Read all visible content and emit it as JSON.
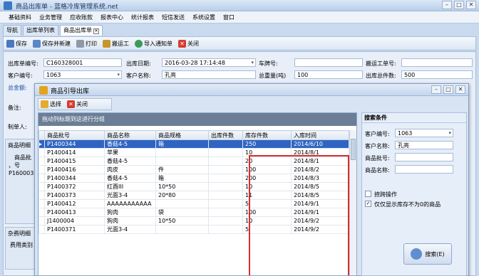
{
  "window": {
    "title": "商品出库单 - 蓝格冷库管理系统.net"
  },
  "menu": [
    "基础资料",
    "业务管理",
    "应收账款",
    "报表中心",
    "统计报表",
    "短信发送",
    "系统设置",
    "窗口"
  ],
  "tabs": [
    "导航",
    "出库单列表",
    "商品出库单"
  ],
  "toolbar": {
    "save": "保存",
    "save_new": "保存并新建",
    "print": "打印",
    "carry": "搬运工",
    "import": "导入通知单",
    "close": "关闭"
  },
  "form": {
    "no_label": "出库单编号:",
    "no_value": "C160328001",
    "date_label": "出库日期:",
    "date_value": "2016-03-28  17:14:48",
    "car_label": "车牌号:",
    "worker_label": "搬运工单号:",
    "cust_label": "客户编号:",
    "cust_value": "1063",
    "custname_label": "客户名称:",
    "custname_value": "孔亮",
    "weight_label": "总重量(吨)",
    "weight_value": "100",
    "count_label": "出库总件数:",
    "count_value": "500",
    "total_label": "总金额:",
    "note_label": "备注:",
    "maker_label": "制单人:",
    "detail_tab": "商品明细",
    "detail_col": "商品批号",
    "detail_row": "P160003",
    "misc_tab": "杂费明细",
    "misc_col": "费用类别"
  },
  "dialog": {
    "title": "商品引导出库",
    "select": "选择",
    "close": "关闭",
    "group_hint": "拖动列标题到这进行分组",
    "columns": [
      "商品批号",
      "商品名称",
      "商品规格",
      "出库件数",
      "库存件数",
      "入库时间"
    ],
    "rows": [
      [
        "P1400344",
        "香菇4-5",
        "箱",
        "",
        "250",
        "2014/6/10"
      ],
      [
        "P1400414",
        "苹果",
        "",
        "",
        "10",
        "2014/8/1"
      ],
      [
        "P1400415",
        "香菇4-5",
        "",
        "",
        "20",
        "2014/8/1"
      ],
      [
        "P1400416",
        "肉皮",
        "件",
        "",
        "100",
        "2014/8/2"
      ],
      [
        "P1400344",
        "香菇4-5",
        "箱",
        "",
        "200",
        "2014/8/3"
      ],
      [
        "P1400372",
        "红酉III",
        "10*50",
        "",
        "10",
        "2014/8/5"
      ],
      [
        "P1400373",
        "光面3-4",
        "20*80",
        "",
        "11",
        "2014/8/5"
      ],
      [
        "P1400412",
        "AAAAAAAAAAA",
        "",
        "",
        "5",
        "2014/9/1"
      ],
      [
        "P1400413",
        "狗肉",
        "袋",
        "",
        "100",
        "2014/9/1"
      ],
      [
        "J1400004",
        "狗肉",
        "10*50",
        "",
        "10",
        "2014/9/2"
      ],
      [
        "P1400371",
        "光面3-4",
        "",
        "",
        "5",
        "2014/9/2"
      ]
    ],
    "search": {
      "header": "搜索条件",
      "cust_no_label": "客户编号:",
      "cust_no_value": "1063",
      "cust_name_label": "客户名称:",
      "cust_name_value": "孔亮",
      "batch_label": "商品批号:",
      "name_label": "商品名称:",
      "fuzzy_label": "捺跨操作",
      "nonzero_label": "仅仅显示库存不为0的商品",
      "button": "搜索(E)"
    }
  }
}
